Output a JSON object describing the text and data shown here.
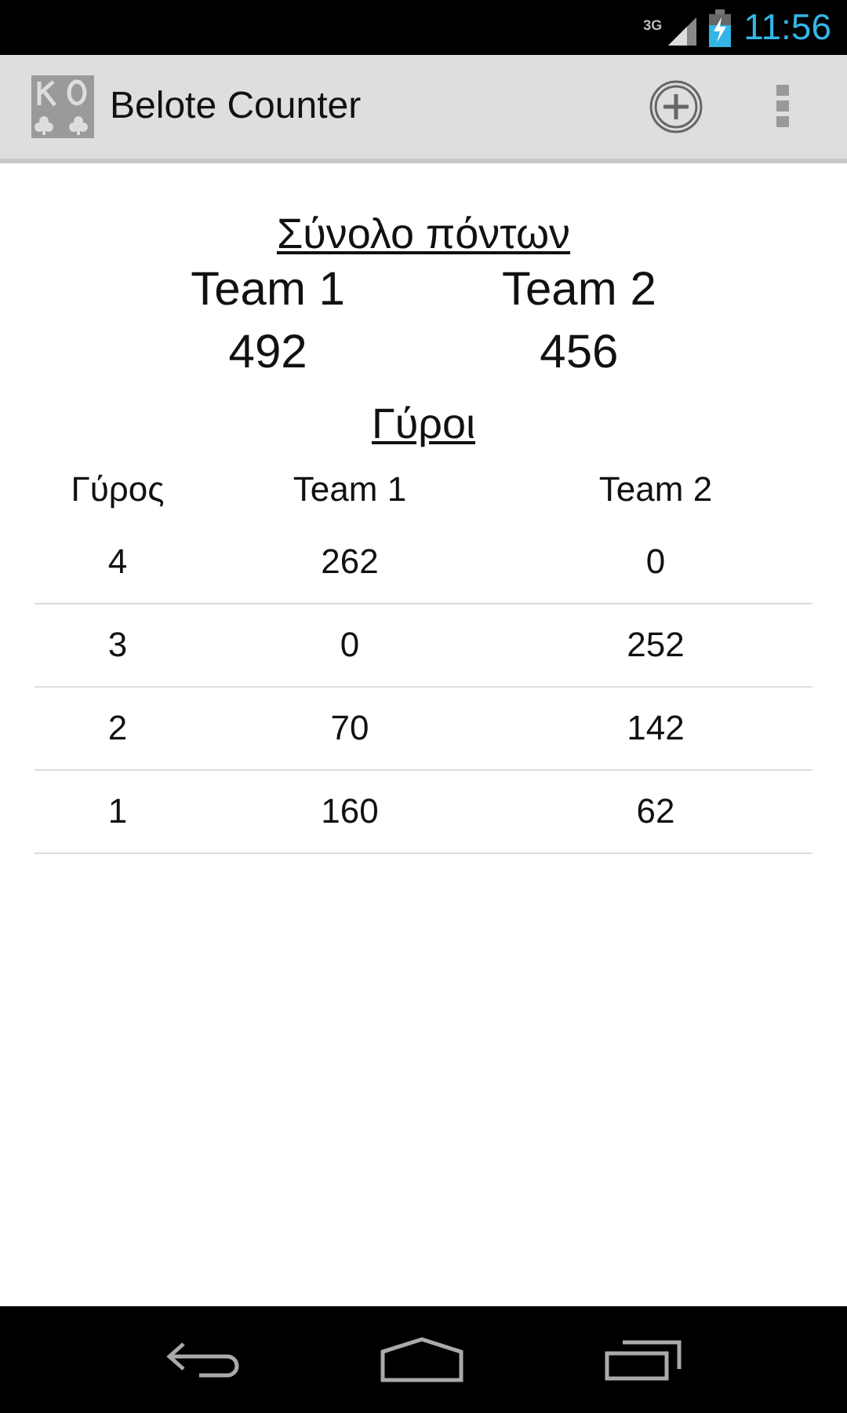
{
  "status_bar": {
    "network": "3G",
    "time": "11:56"
  },
  "action_bar": {
    "title": "Belote Counter"
  },
  "totals": {
    "title": "Σύνολο πόντων",
    "teams": [
      {
        "name": "Team 1",
        "score": "492"
      },
      {
        "name": "Team 2",
        "score": "456"
      }
    ]
  },
  "rounds": {
    "title": "Γύροι",
    "columns": [
      "Γύρος",
      "Team 1",
      "Team 2"
    ],
    "rows": [
      [
        "4",
        "262",
        "0"
      ],
      [
        "3",
        "0",
        "252"
      ],
      [
        "2",
        "70",
        "142"
      ],
      [
        "1",
        "160",
        "62"
      ]
    ]
  }
}
